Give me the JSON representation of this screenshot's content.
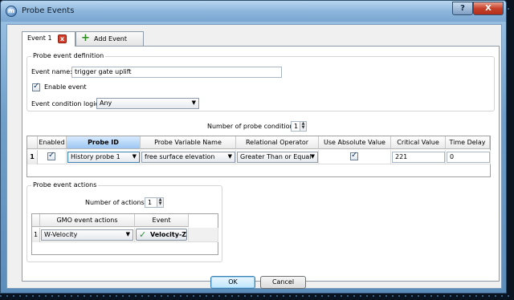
{
  "window": {
    "title": "Probe Events",
    "help_label": "?",
    "close_label": "X",
    "app_icon": "mp-app-icon"
  },
  "tabs": [
    {
      "label": "Event 1",
      "close_label": "x"
    },
    {
      "label": "Add Event",
      "plus_label": "+"
    }
  ],
  "definition": {
    "group_title": "Probe event definition",
    "event_name_label": "Event name:",
    "event_name_value": "trigger gate uplift",
    "enable_label": "Enable event",
    "enable_checked": true,
    "logic_label": "Event condition logic",
    "logic_value": "Any"
  },
  "conditions": {
    "count_label": "Number of probe conditions:",
    "count_value": "1",
    "headers": [
      "Enabled",
      "Probe ID",
      "Probe Variable Name",
      "Relational Operator",
      "Use Absolute Value",
      "Critical Value",
      "Time Delay"
    ],
    "rows": [
      {
        "index": "1",
        "enabled": true,
        "probe_id": "History probe 1",
        "variable": "free surface elevation",
        "operator": "Greater Than or Equal",
        "use_abs": true,
        "critical_value": "221",
        "time_delay": "0"
      }
    ]
  },
  "actions": {
    "group_title": "Probe event actions",
    "count_label": "Number of actions",
    "count_value": "1",
    "headers": [
      "GMO event actions",
      "Event"
    ],
    "rows": [
      {
        "index": "1",
        "action": "W-Velocity",
        "event": "Velocity-Z"
      }
    ]
  },
  "footer": {
    "ok_label": "OK",
    "cancel_label": "Cancel"
  }
}
